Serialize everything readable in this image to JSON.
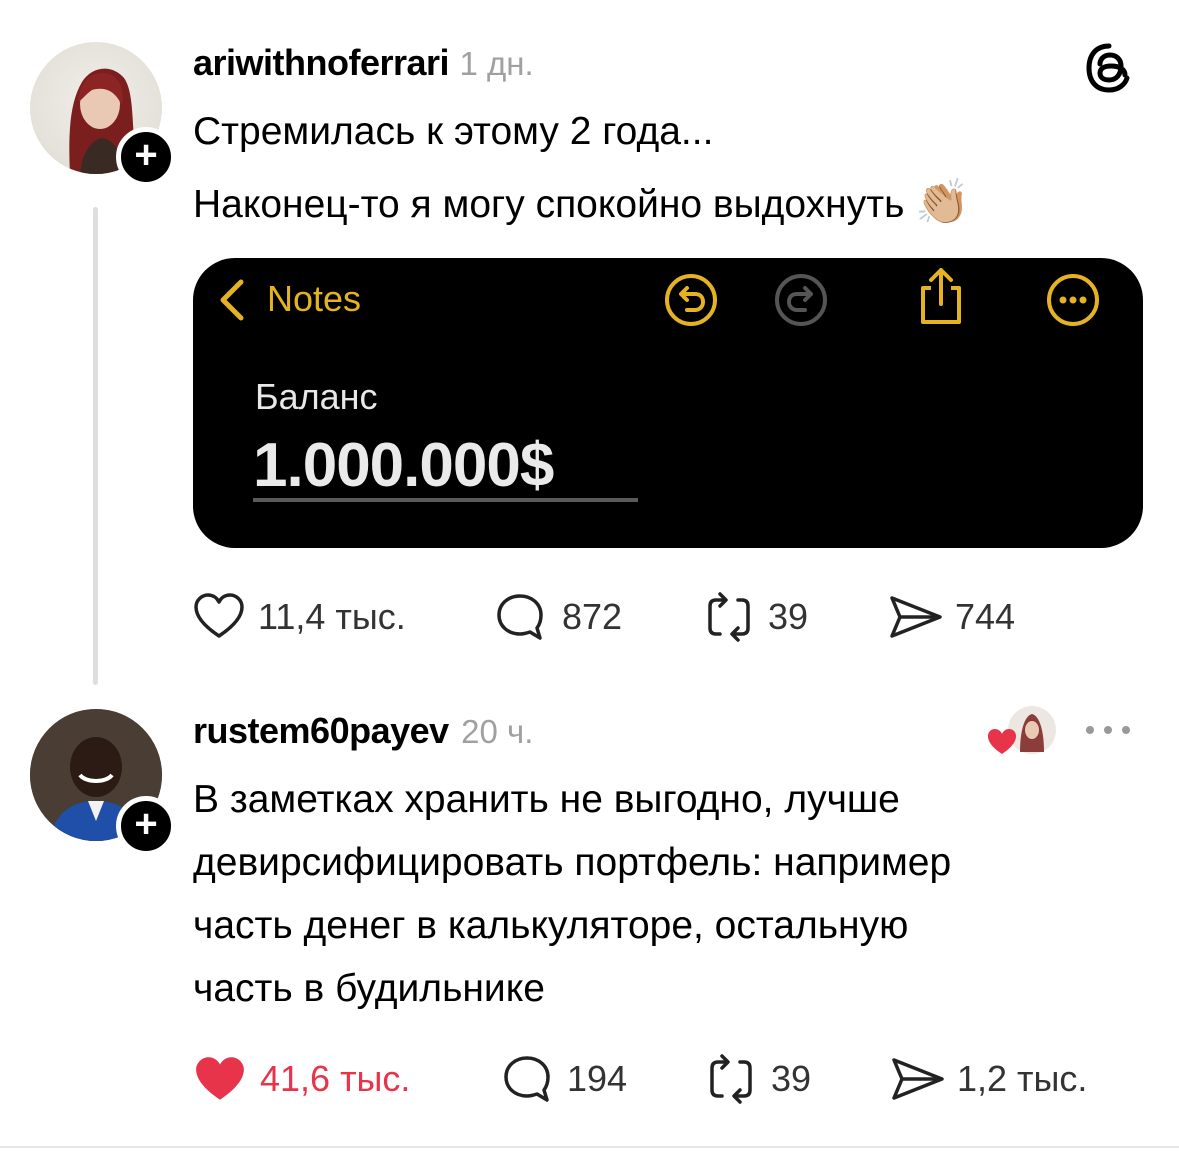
{
  "post": {
    "username": "ariwithnoferrari",
    "time": "1 дн.",
    "line1": "Стремилась к этому 2 года...",
    "line2": "Наконец-то я могу спокойно выдохнуть",
    "emoji": "👏🏼",
    "app_icon": "threads-icon",
    "note": {
      "back_label": "Notes",
      "title": "Баланс",
      "value": "1.000.000$"
    },
    "stats": {
      "likes": "11,4 тыс.",
      "replies": "872",
      "reposts": "39",
      "shares": "744"
    }
  },
  "reply": {
    "username": "rustem60payev",
    "time": "20 ч.",
    "text_lines": [
      "В заметках хранить не выгодно, лучше",
      "девирсифицировать портфель: например",
      "часть денег в калькуляторе, остальную",
      "часть в будильнике"
    ],
    "stats": {
      "likes": "41,6 тыс.",
      "replies": "194",
      "reposts": "39",
      "shares": "1,2 тыс."
    }
  },
  "colors": {
    "like_red": "#e8344a",
    "notes_gold": "#e5b322",
    "muted": "#a0a0a0"
  }
}
